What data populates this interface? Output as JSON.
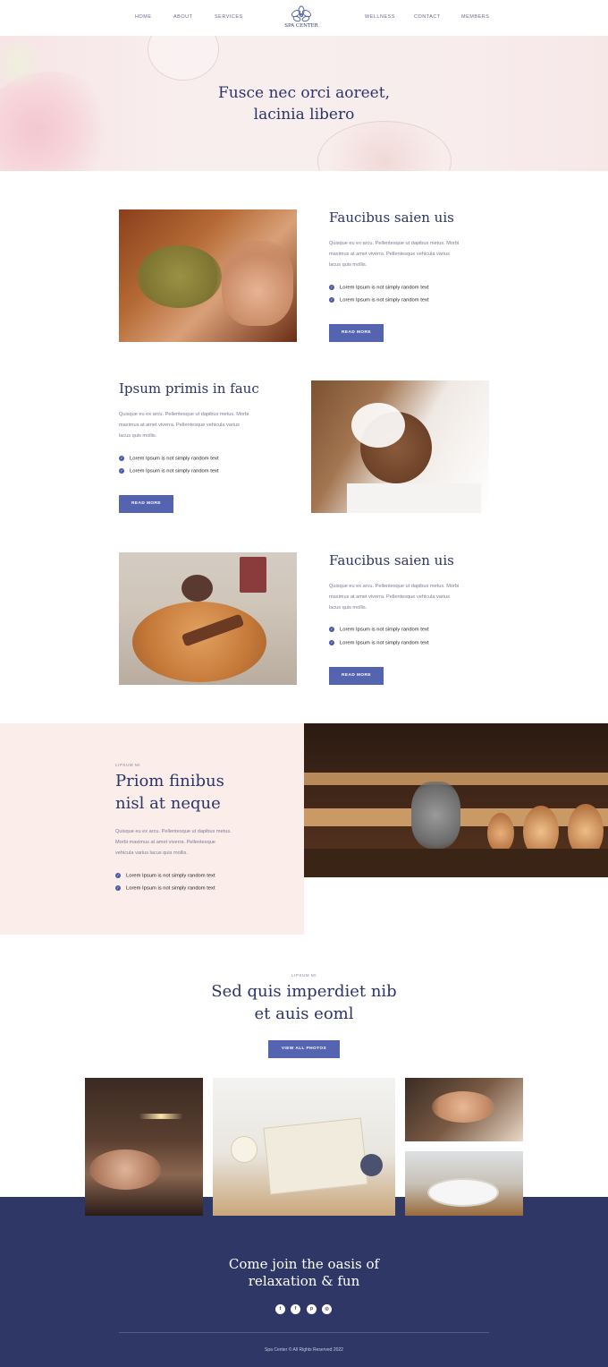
{
  "nav": {
    "left": [
      "HOME",
      "ABOUT",
      "SERVICES"
    ],
    "right": [
      "WELLNESS",
      "CONTACT",
      "MEMBERS"
    ],
    "logo_text": "SPA CENTER"
  },
  "hero": {
    "title_line1": "Fusce nec orci aoreet,",
    "title_line2": "lacinia libero"
  },
  "features": [
    {
      "title": "Faucibus saien uis",
      "para1": "Quisque eu ex arcu. Pellentesque ut dapibus metus. Morbi",
      "para2": "maximus at amet viverra. Pellentesque vehicula varius",
      "para3": "lacus quis mollis.",
      "checks": [
        "Lorem Ipsum is not simply random text",
        "Lorem Ipsum is not simply random text"
      ],
      "button": "READ MORE"
    },
    {
      "title": "Ipsum primis in fauc",
      "para1": "Quisque eu ex arcu. Pellentesque ut dapibus metus. Morbi",
      "para2": "maximus at amet viverra. Pellentesque vehicula varius",
      "para3": "lacus quis mollis.",
      "checks": [
        "Lorem Ipsum is not simply random text",
        "Lorem Ipsum is not simply random text"
      ],
      "button": "READ MORE"
    },
    {
      "title": "Faucibus saien uis",
      "para1": "Quisque eu ex arcu. Pellentesque ut dapibus metus. Morbi",
      "para2": "maximus at amet viverra. Pellentesque vehicula varius",
      "para3": "lacus quis mollis.",
      "checks": [
        "Lorem Ipsum is not simply random text",
        "Lorem Ipsum is not simply random text"
      ],
      "button": "READ MORE"
    }
  ],
  "pink_section": {
    "eyebrow": "LIPSUM MI",
    "title_line1": "Priom finibus",
    "title_line2": "nisl at neque",
    "para1": "Quisque eu ex arcu. Pellentesque ut dapibus metus.",
    "para2": "Morbi maximus at amet viverra. Pellentesque",
    "para3": "vehicula varius lacus quis mollis.",
    "checks": [
      "Lorem Ipsum is not simply random text",
      "Lorem Ipsum is not simply random text"
    ]
  },
  "gallery": {
    "eyebrow": "LIPSUM MI",
    "title_line1": "Sed quis imperdiet nib",
    "title_line2": "et auis eoml",
    "button": "VIEW ALL PHOTOS"
  },
  "footer": {
    "title_line1": "Come join the oasis of",
    "title_line2": "relaxation & fun",
    "social": [
      "twitter-icon",
      "facebook-icon",
      "pinterest-icon",
      "instagram-icon"
    ],
    "social_glyphs": [
      "t",
      "f",
      "p",
      "◎"
    ],
    "copyright": "Spa Center © All Rights Reserved 2022"
  },
  "colors": {
    "accent": "#5564b0",
    "navy": "#2e3766",
    "heading": "#2b3468",
    "pink": "#fbeeea"
  }
}
